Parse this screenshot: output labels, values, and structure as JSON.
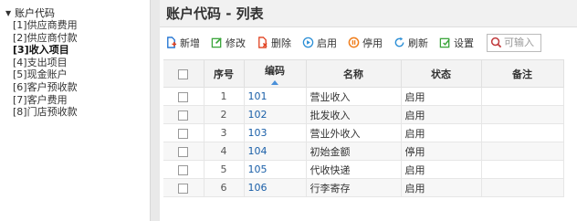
{
  "tree": {
    "root_label": "账户代码",
    "items": [
      {
        "label": "[1]供应商费用",
        "active": false
      },
      {
        "label": "[2]供应商付款",
        "active": false
      },
      {
        "label": "[3]收入项目",
        "active": true
      },
      {
        "label": "[4]支出项目",
        "active": false
      },
      {
        "label": "[5]现金账户",
        "active": false
      },
      {
        "label": "[6]客户预收款",
        "active": false
      },
      {
        "label": "[7]客户费用",
        "active": false
      },
      {
        "label": "[8]门店预收款",
        "active": false
      }
    ]
  },
  "header": {
    "title": "账户代码 - 列表"
  },
  "toolbar": {
    "new_label": "新增",
    "edit_label": "修改",
    "delete_label": "删除",
    "enable_label": "启用",
    "disable_label": "停用",
    "refresh_label": "刷新",
    "settings_label": "设置",
    "search_placeholder": "可输入"
  },
  "colors": {
    "new": "#1a6fd1",
    "edit": "#3aa53a",
    "delete": "#e0401f",
    "enable": "#2c8fd6",
    "disable": "#f07d1a",
    "refresh": "#2c8fd6",
    "settings": "#3aa53a",
    "search": "#c0393b",
    "code_link": "#1a5fa8"
  },
  "table": {
    "columns": {
      "seq": "序号",
      "code": "编码",
      "name": "名称",
      "status": "状态",
      "remark": "备注"
    },
    "rows": [
      {
        "seq": "1",
        "code": "101",
        "name": "营业收入",
        "status": "启用",
        "remark": ""
      },
      {
        "seq": "2",
        "code": "102",
        "name": "批发收入",
        "status": "启用",
        "remark": ""
      },
      {
        "seq": "3",
        "code": "103",
        "name": "营业外收入",
        "status": "启用",
        "remark": ""
      },
      {
        "seq": "4",
        "code": "104",
        "name": "初始金额",
        "status": "停用",
        "remark": ""
      },
      {
        "seq": "5",
        "code": "105",
        "name": "代收快递",
        "status": "启用",
        "remark": ""
      },
      {
        "seq": "6",
        "code": "106",
        "name": "行李寄存",
        "status": "启用",
        "remark": ""
      }
    ]
  }
}
